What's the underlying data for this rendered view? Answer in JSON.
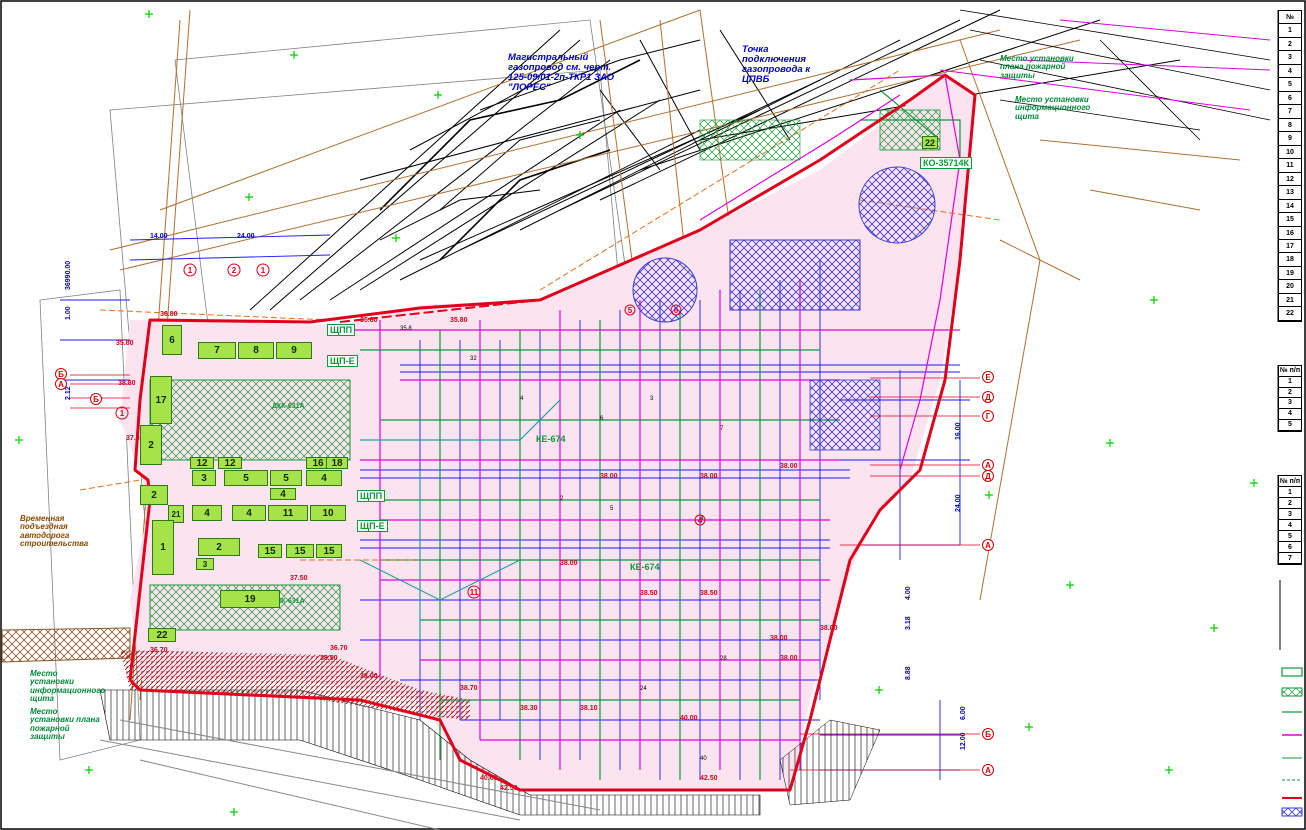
{
  "notes": {
    "gas_main": "Магистральный газопровод см. черт. 125-09/01-2п-ТКР1 ЗАО \"ЛОРЕС\"",
    "gas_point": "Точка подключения газопровода к ЦПВБ",
    "fire_panel_top": "Место установки плана пожарной защиты",
    "info_panel_top": "Место установки информационного щита",
    "temp_road": "Временная подъездная автодорога строительства",
    "info_panel_bottom": "Место установки информационного щита",
    "fire_panel_bottom": "Место установки плана пожарной защиты"
  },
  "labels": {
    "ko_top": "КО-35714К",
    "dkk_top": "ДКК-631А",
    "dkk_bottom": "ДКК-631А",
    "ke674_a": "КЕ-674",
    "ke674_b": "КЕ-674",
    "shpp_1": "ЩПП",
    "shp_e_1": "ЩП-Е",
    "shpp_2": "ЩПП",
    "shp_e_2": "ЩП-Е",
    "dim_14": "14.00",
    "dim_24": "24.00",
    "dim_1200": "12.00",
    "num_22_top": "22"
  },
  "buildings": [
    {
      "id": "6",
      "label": "6"
    },
    {
      "id": "7",
      "label": "7"
    },
    {
      "id": "8",
      "label": "8"
    },
    {
      "id": "9",
      "label": "9"
    },
    {
      "id": "17",
      "label": "17"
    },
    {
      "id": "2a",
      "label": "2"
    },
    {
      "id": "12a",
      "label": "12"
    },
    {
      "id": "12b",
      "label": "12"
    },
    {
      "id": "16a",
      "label": "16"
    },
    {
      "id": "18",
      "label": "18"
    },
    {
      "id": "3a",
      "label": "3"
    },
    {
      "id": "5a",
      "label": "5"
    },
    {
      "id": "5b",
      "label": "5"
    },
    {
      "id": "4a",
      "label": "4"
    },
    {
      "id": "4b",
      "label": "4"
    },
    {
      "id": "2b",
      "label": "2"
    },
    {
      "id": "21",
      "label": "21"
    },
    {
      "id": "4c",
      "label": "4"
    },
    {
      "id": "4d",
      "label": "4"
    },
    {
      "id": "11",
      "label": "11"
    },
    {
      "id": "10",
      "label": "10"
    },
    {
      "id": "1",
      "label": "1"
    },
    {
      "id": "2c",
      "label": "2"
    },
    {
      "id": "15a",
      "label": "15"
    },
    {
      "id": "15b",
      "label": "15"
    },
    {
      "id": "15c",
      "label": "15"
    },
    {
      "id": "3b",
      "label": "3"
    },
    {
      "id": "19",
      "label": "19"
    },
    {
      "id": "22",
      "label": "22"
    }
  ],
  "axes": [
    "Б",
    "А",
    "Б",
    "Д",
    "Г",
    "Е",
    "А",
    "Д",
    "А",
    "Б",
    "А"
  ],
  "side_table_top": [
    "№",
    "1",
    "2",
    "3",
    "4",
    "5",
    "6",
    "7",
    "8",
    "9",
    "10",
    "11",
    "12",
    "13",
    "14",
    "15",
    "16",
    "17",
    "18",
    "19",
    "20",
    "21",
    "22"
  ],
  "side_table_mid": [
    "№ п/п",
    "1",
    "2",
    "3",
    "4",
    "5"
  ],
  "side_table_low": [
    "№ п/п",
    "1",
    "2",
    "3",
    "4",
    "5",
    "6",
    "7"
  ],
  "colors": {
    "boundary": "#e0001c",
    "site_fill": "#fbe3ef",
    "building": "#a6e34a",
    "hatch_blue": "#3a3ad8",
    "magenta": "#e000e0",
    "green": "#0a9a3a",
    "brown": "#b07030"
  }
}
